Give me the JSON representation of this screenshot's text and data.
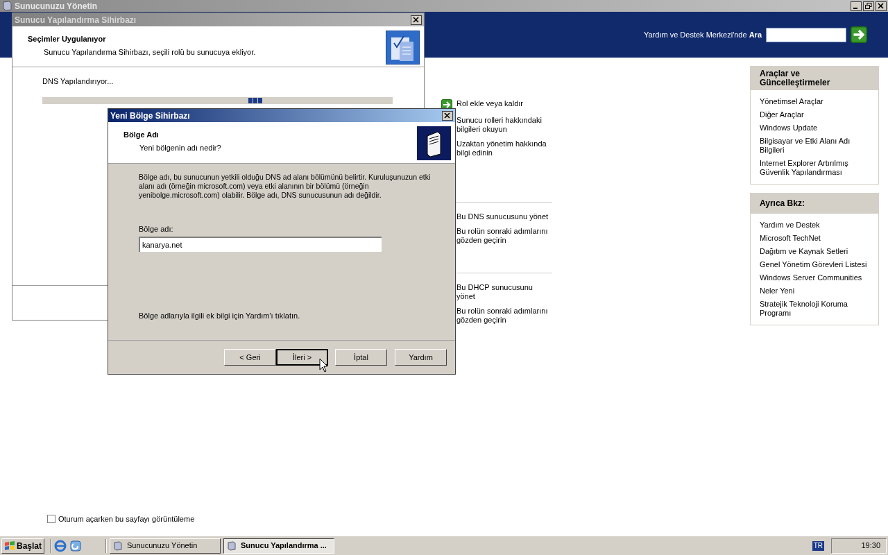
{
  "main_window": {
    "title": "Sunucunuzu Yönetin",
    "search_label": "Yardım ve Destek Merkezi'nde **Ara**"
  },
  "role_groups": [
    {
      "links": [
        {
          "label": "Rol ekle veya kaldır",
          "kind": "arrow"
        },
        {
          "label": "Sunucu rolleri hakkındaki bilgileri okuyun",
          "kind": "plain"
        },
        {
          "label": "Uzaktan yönetim hakkında bilgi edinin",
          "kind": "plain"
        }
      ]
    },
    {
      "links": [
        {
          "label": "Bu DNS sunucusunu yönet",
          "kind": "plain"
        },
        {
          "label": "Bu rolün sonraki adımlarını gözden geçirin",
          "kind": "plain"
        }
      ]
    },
    {
      "links": [
        {
          "label": "Bu DHCP sunucusunu yönet",
          "kind": "plain"
        },
        {
          "label": "Bu rolün sonraki adımlarını gözden geçirin",
          "kind": "plain"
        }
      ]
    }
  ],
  "side_panels": [
    {
      "title": "Araçlar ve Güncelleştirmeler",
      "links": [
        "Yönetimsel Araçlar",
        "Diğer Araçlar",
        "Windows Update",
        "Bilgisayar ve Etki Alanı Adı Bilgileri",
        "Internet Explorer Artırılmış Güvenlik Yapılandırması"
      ]
    },
    {
      "title": "Ayrıca Bkz:",
      "links": [
        "Yardım ve Destek",
        "Microsoft TechNet",
        "Dağıtım ve Kaynak Setleri",
        "Genel Yönetim Görevleri Listesi",
        "Windows Server Communities",
        "Neler Yeni",
        "Stratejik Teknoloji Koruma Programı"
      ]
    }
  ],
  "startup_checkbox": {
    "label": "Oturum açarken bu sayfayı görüntüleme",
    "checked": false
  },
  "config_wizard": {
    "title": "Sunucu Yapılandırma Sihirbazı",
    "heading": "Seçimler Uygulanıyor",
    "subheading": "Sunucu Yapılandırma Sihirbazı, seçili rolü bu sunucuya ekliyor.",
    "status": "DNS Yapılandırıyor..."
  },
  "zone_wizard": {
    "title": "Yeni Bölge Sihirbazı",
    "heading": "Bölge Adı",
    "subheading": "Yeni bölgenin adı nedir?",
    "description": "Bölge adı, bu sunucunun yetkili olduğu DNS ad alanı bölümünü belirtir. Kuruluşunuzun etki alanı adı (örneğin microsoft.com) veya etki alanının bir bölümü (örneğin yenibolge.microsoft.com) olabilir. Bölge adı, DNS sunucusunun adı değildir.",
    "field_label": "Bölge adı:",
    "field_value": "kanarya.net",
    "help_text": "Bölge adlarıyla ilgili ek bilgi için Yardım'ı tıklatın.",
    "buttons": [
      {
        "label": "< Geri",
        "default": false
      },
      {
        "label": "İleri >",
        "default": true
      },
      {
        "label": "İptal",
        "default": false
      },
      {
        "label": "Yardım",
        "default": false
      }
    ]
  },
  "taskbar": {
    "start": "Başlat",
    "tasks": [
      {
        "label": "Sunucunuzu Yönetin",
        "selected": false
      },
      {
        "label": "Sunucu Yapılandırma ...",
        "selected": true
      }
    ],
    "language": "TR",
    "clock": "19:30"
  }
}
